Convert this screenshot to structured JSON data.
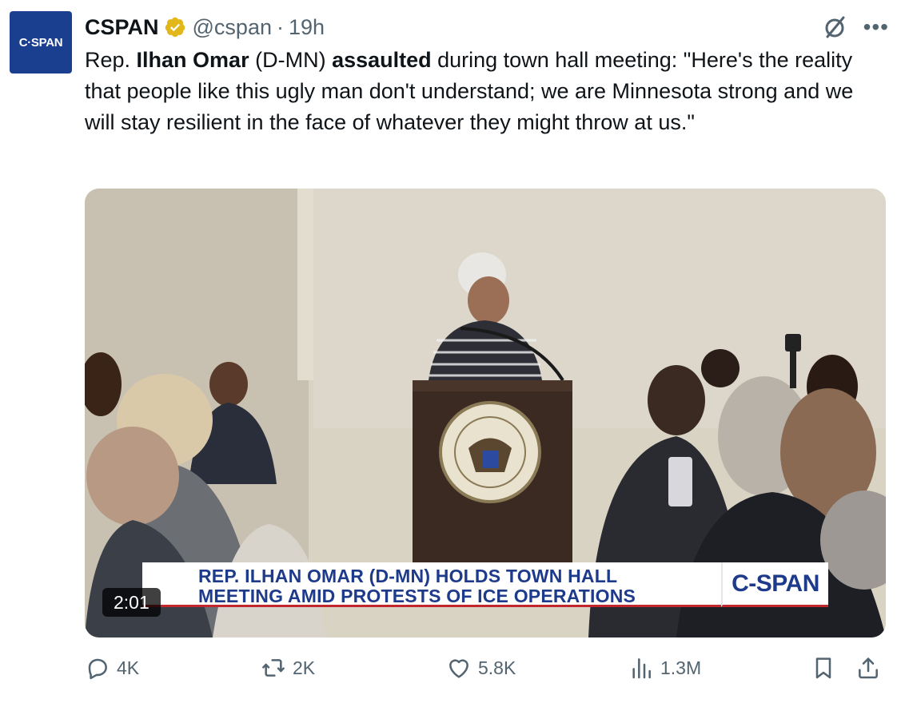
{
  "avatar": {
    "label": "C·SPAN"
  },
  "author": {
    "display_name": "CSPAN",
    "handle": "@cspan",
    "separator": "·",
    "time": "19h"
  },
  "tweet": {
    "seg1": "Rep. ",
    "seg2_bold": "Ilhan Omar",
    "seg3": " (D-MN) ",
    "seg4_bold": "assaulted",
    "seg5": " during town hall meeting: \"Here's the reality that people like this ugly man don't understand; we are Minnesota strong and we will stay resilient in the face of whatever they might throw at us.\""
  },
  "media": {
    "chyron_line1": "REP. ILHAN OMAR (D-MN) HOLDS TOWN HALL",
    "chyron_line2": "MEETING AMID PROTESTS OF ICE OPERATIONS",
    "logo": "C-SPAN",
    "duration": "2:01"
  },
  "actions": {
    "replies": "4K",
    "reposts": "2K",
    "likes": "5.8K",
    "views": "1.3M"
  },
  "colors": {
    "accent_navy": "#1e3a8a",
    "chyron_red": "#c1272d",
    "muted_text": "#536471",
    "verified_gold": "#e2b719"
  }
}
